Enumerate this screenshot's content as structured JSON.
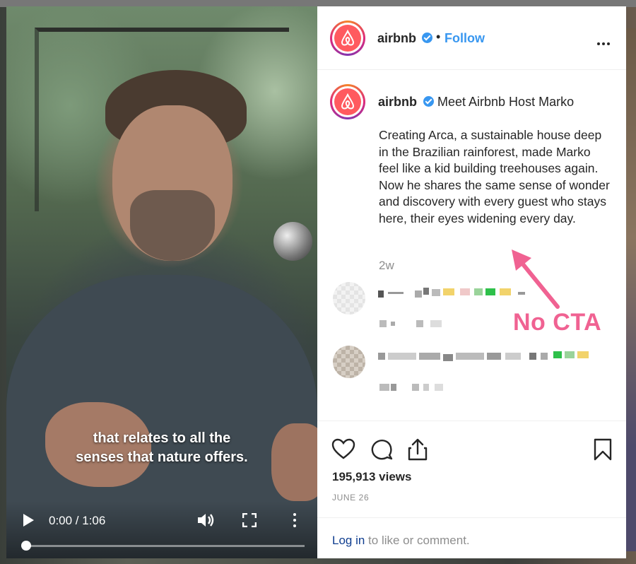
{
  "video": {
    "caption_line1": "that relates to all the",
    "caption_line2": "senses that nature offers.",
    "time": "0:00 / 1:06",
    "progress_fraction": 0.0
  },
  "header": {
    "username": "airbnb",
    "dot": "•",
    "follow_label": "Follow"
  },
  "caption": {
    "username": "airbnb",
    "title": "Meet Airbnb Host Marko",
    "text": "Creating Arca, a sustainable house deep in the Brazilian rainforest, made Marko feel like a kid building treehouses again. Now he shares the same sense of wonder and discovery with every guest who stays here, their eyes widening every day.",
    "time_ago": "2w"
  },
  "annotation": {
    "label": "No CTA",
    "color": "#f06292"
  },
  "stats": {
    "views": "195,913 views",
    "date": "JUNE 26"
  },
  "login": {
    "link": "Log in",
    "rest": " to like or comment."
  },
  "colors": {
    "accent": "#3897f0",
    "brand": "#ff5a5f"
  }
}
